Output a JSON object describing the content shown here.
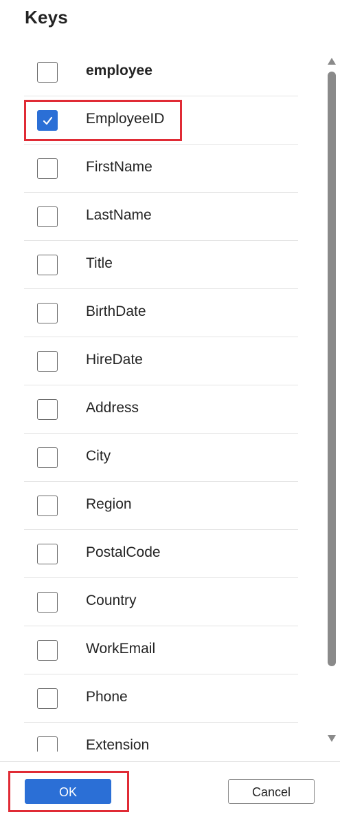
{
  "dialog": {
    "title": "Keys"
  },
  "keys_list": {
    "table_name": "employee",
    "columns": [
      {
        "label": "EmployeeID",
        "checked": true
      },
      {
        "label": "FirstName",
        "checked": false
      },
      {
        "label": "LastName",
        "checked": false
      },
      {
        "label": "Title",
        "checked": false
      },
      {
        "label": "BirthDate",
        "checked": false
      },
      {
        "label": "HireDate",
        "checked": false
      },
      {
        "label": "Address",
        "checked": false
      },
      {
        "label": "City",
        "checked": false
      },
      {
        "label": "Region",
        "checked": false
      },
      {
        "label": "PostalCode",
        "checked": false
      },
      {
        "label": "Country",
        "checked": false
      },
      {
        "label": "WorkEmail",
        "checked": false
      },
      {
        "label": "Phone",
        "checked": false
      },
      {
        "label": "Extension",
        "checked": false
      }
    ]
  },
  "footer": {
    "ok_label": "OK",
    "cancel_label": "Cancel"
  },
  "colors": {
    "accent": "#2b6fd6",
    "annotation_highlight": "#e02b35"
  },
  "icons": {
    "checkmark": "check-icon",
    "scroll_up": "triangle-up-icon",
    "scroll_down": "triangle-down-icon"
  }
}
